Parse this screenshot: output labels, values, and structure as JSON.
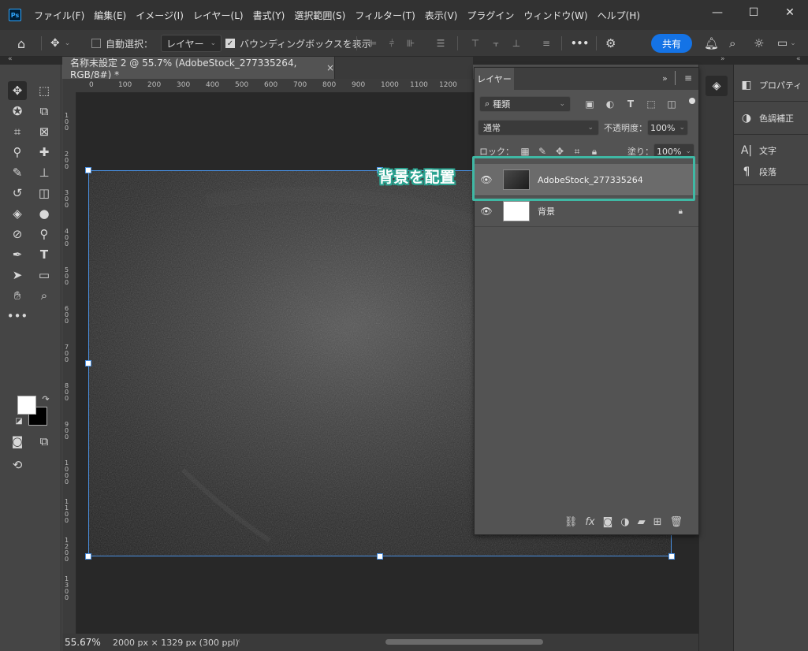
{
  "app": {
    "logo": "Ps"
  },
  "menu": [
    "ファイル(F)",
    "編集(E)",
    "イメージ(I)",
    "レイヤー(L)",
    "書式(Y)",
    "選択範囲(S)",
    "フィルター(T)",
    "表示(V)",
    "プラグイン",
    "ウィンドウ(W)",
    "ヘルプ(H)"
  ],
  "window_controls": {
    "minimize": "—",
    "maximize": "☐",
    "close": "✕"
  },
  "options_bar": {
    "auto_select_label": "自動選択：",
    "auto_select_checked": false,
    "target_dropdown": "レイヤー",
    "bounding_box_label": "バウンディングボックスを表示",
    "bounding_box_checked": true,
    "share_label": "共有",
    "more_label": "•••"
  },
  "document": {
    "tab_title": "名称未設定 2 @ 55.7% (AdobeStock_277335264, RGB/8#) *",
    "close_glyph": "×"
  },
  "ruler": {
    "h_ticks": [
      "0",
      "100",
      "200",
      "300",
      "400",
      "500",
      "600",
      "700",
      "800",
      "900",
      "1000",
      "1100",
      "1200"
    ],
    "v_ticks": [
      "1 0 0",
      "2 0 0",
      "3 0 0",
      "4 0 0",
      "5 0 0",
      "6 0 0",
      "7 0 0",
      "8 0 0",
      "9 0 0",
      "1 0 0 0",
      "1 1 0 0",
      "1 2 0 0",
      "1 3 0 0"
    ]
  },
  "status": {
    "zoom": "55.67%",
    "info": "2000 px × 1329 px (300 ppl)"
  },
  "layers_panel": {
    "tab": "レイヤー",
    "kind_filter": "種類",
    "blend_mode": "通常",
    "opacity_label": "不透明度：",
    "opacity_value": "100%",
    "lock_label": "ロック：",
    "fill_label": "塗り：",
    "fill_value": "100%",
    "layers": [
      {
        "name": "AdobeStock_277335264",
        "selected": true
      },
      {
        "name": "背景",
        "selected": false,
        "locked": true
      }
    ]
  },
  "dock": {
    "items": [
      {
        "icon": "properties-icon",
        "label": "プロパティ"
      },
      {
        "icon": "adjustments-icon",
        "label": "色調補正"
      },
      {
        "icon": "character-icon",
        "label": "文字"
      },
      {
        "icon": "paragraph-icon",
        "label": "段落"
      }
    ]
  },
  "callout": {
    "text": "背景を配置",
    "color": "#3fb8a4"
  }
}
